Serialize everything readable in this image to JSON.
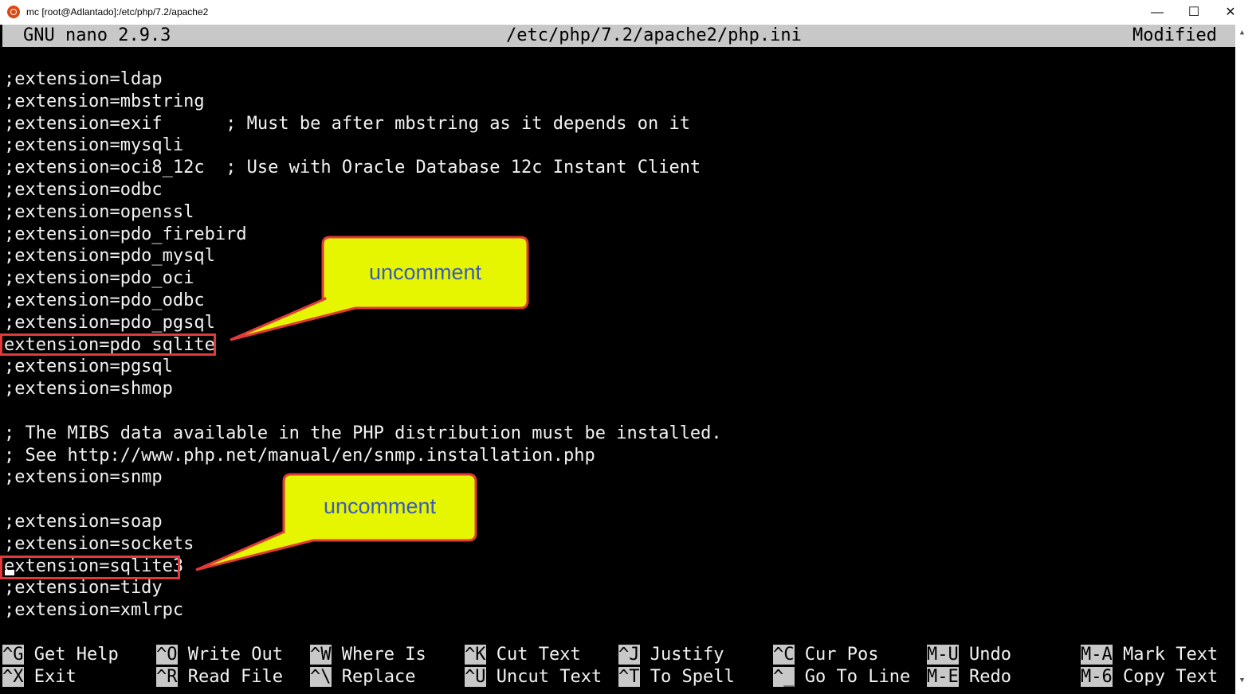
{
  "window": {
    "title": "mc [root@Adlantado]:/etc/php/7.2/apache2",
    "minimize_glyph": "—",
    "maximize_glyph": "☐",
    "close_glyph": "✕"
  },
  "nano": {
    "version": "GNU nano 2.9.3",
    "file": "/etc/php/7.2/apache2/php.ini",
    "status": "Modified"
  },
  "lines": [
    ";extension=ldap",
    ";extension=mbstring",
    ";extension=exif      ; Must be after mbstring as it depends on it",
    ";extension=mysqli",
    ";extension=oci8_12c  ; Use with Oracle Database 12c Instant Client",
    ";extension=odbc",
    ";extension=openssl",
    ";extension=pdo_firebird",
    ";extension=pdo_mysql",
    ";extension=pdo_oci",
    ";extension=pdo_odbc",
    ";extension=pdo_pgsql",
    "extension=pdo_sqlite",
    ";extension=pgsql",
    ";extension=shmop",
    "",
    "; The MIBS data available in the PHP distribution must be installed.",
    "; See http://www.php.net/manual/en/snmp.installation.php",
    ";extension=snmp",
    "",
    ";extension=soap",
    ";extension=sockets",
    "extension=sqlite3",
    ";extension=tidy",
    ";extension=xmlrpc"
  ],
  "shortcuts_row1": [
    {
      "key": "^G",
      "label": "Get Help"
    },
    {
      "key": "^O",
      "label": "Write Out"
    },
    {
      "key": "^W",
      "label": "Where Is"
    },
    {
      "key": "^K",
      "label": "Cut Text"
    },
    {
      "key": "^J",
      "label": "Justify"
    },
    {
      "key": "^C",
      "label": "Cur Pos"
    },
    {
      "key": "M-U",
      "label": "Undo"
    },
    {
      "key": "M-A",
      "label": "Mark Text"
    }
  ],
  "shortcuts_row2": [
    {
      "key": "^X",
      "label": "Exit"
    },
    {
      "key": "^R",
      "label": "Read File"
    },
    {
      "key": "^\\",
      "label": "Replace"
    },
    {
      "key": "^U",
      "label": "Uncut Text"
    },
    {
      "key": "^T",
      "label": "To Spell"
    },
    {
      "key": "^_",
      "label": "Go To Line"
    },
    {
      "key": "M-E",
      "label": "Redo"
    },
    {
      "key": "M-6",
      "label": "Copy Text"
    }
  ],
  "annotations": [
    {
      "text": "uncomment"
    },
    {
      "text": "uncomment"
    }
  ],
  "colors": {
    "terminal_bg": "#000000",
    "header_bg": "#c8c8c8",
    "callout_fill": "#e6f500",
    "callout_border": "#e03a3a",
    "callout_text": "#3b5bbd"
  }
}
